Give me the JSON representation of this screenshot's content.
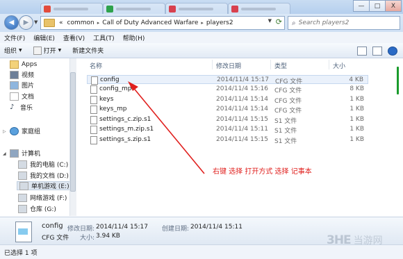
{
  "window": {
    "minimize": "—",
    "maximize": "□",
    "close": "X"
  },
  "address": {
    "overflow": "«",
    "crumbs": [
      "common",
      "Call of Duty Advanced Warfare",
      "players2"
    ],
    "separator": "▸"
  },
  "search": {
    "placeholder": "Search players2",
    "icon": "search-icon"
  },
  "menu": [
    "文件(F)",
    "编辑(E)",
    "查看(V)",
    "工具(T)",
    "帮助(H)"
  ],
  "toolbar": {
    "organize": "组织",
    "open": "打开",
    "new_folder": "新建文件夹"
  },
  "nav": {
    "favorites": [
      "Apps",
      "视频",
      "图片",
      "文档",
      "音乐"
    ],
    "homegroup": "家庭组",
    "computer": "计算机",
    "drives": [
      "我的电脑 (C:)",
      "我的文档 (D:)",
      "单机游戏 (E:)",
      "网络游戏 (F:)",
      "仓库 (G:)"
    ]
  },
  "columns": {
    "name": "名称",
    "date": "修改日期",
    "type": "类型",
    "size": "大小"
  },
  "files": [
    {
      "name": "config",
      "date": "2014/11/4 15:17",
      "type": "CFG 文件",
      "size": "4 KB"
    },
    {
      "name": "config_mp",
      "date": "2014/11/4 15:16",
      "type": "CFG 文件",
      "size": "8 KB"
    },
    {
      "name": "keys",
      "date": "2014/11/4 15:14",
      "type": "CFG 文件",
      "size": "1 KB"
    },
    {
      "name": "keys_mp",
      "date": "2014/11/4 15:14",
      "type": "CFG 文件",
      "size": "1 KB"
    },
    {
      "name": "settings_c.zip.s1",
      "date": "2014/11/4 15:15",
      "type": "S1 文件",
      "size": "1 KB"
    },
    {
      "name": "settings_m.zip.s1",
      "date": "2014/11/4 15:11",
      "type": "S1 文件",
      "size": "1 KB"
    },
    {
      "name": "settings_s.zip.s1",
      "date": "2014/11/4 15:15",
      "type": "S1 文件",
      "size": "1 KB"
    }
  ],
  "annotation": "右键  选择 打开方式  选择 记事本",
  "details": {
    "name": "config",
    "type": "CFG 文件",
    "modified_label": "修改日期:",
    "modified_value": "2014/11/4 15:17",
    "created_label": "创建日期:",
    "created_value": "2014/11/4 15:11",
    "size_label": "大小:",
    "size_value": "3.94 KB"
  },
  "status": "已选择 1 项",
  "watermark": {
    "logo": "3HE",
    "text": "当游网"
  },
  "colors": {
    "annotation": "#e0201e",
    "selection": "#eaf1fb"
  }
}
